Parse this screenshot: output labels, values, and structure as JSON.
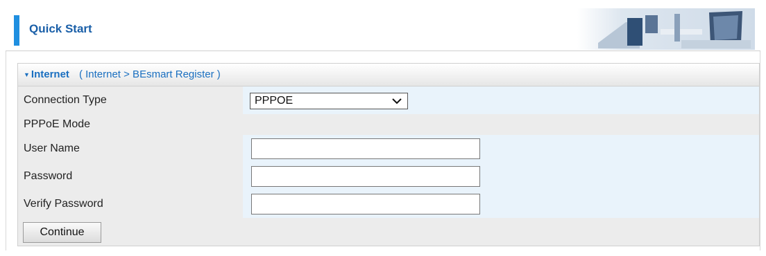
{
  "header": {
    "title": "Quick Start",
    "accent_color": "#1f8fe0",
    "image_icon": "office-desk-illustration-icon"
  },
  "panel": {
    "header_arrow": "▼",
    "header_title": "Internet",
    "breadcrumb": "( Internet  >  BEsmart Register )"
  },
  "form": {
    "connection_type_label": "Connection Type",
    "connection_type_value": "PPPOE",
    "pppoe_mode_label": "PPPoE Mode",
    "user_name_label": "User Name",
    "user_name_value": "",
    "password_label": "Password",
    "password_value": "",
    "verify_password_label": "Verify Password",
    "verify_password_value": "",
    "continue_label": "Continue"
  }
}
